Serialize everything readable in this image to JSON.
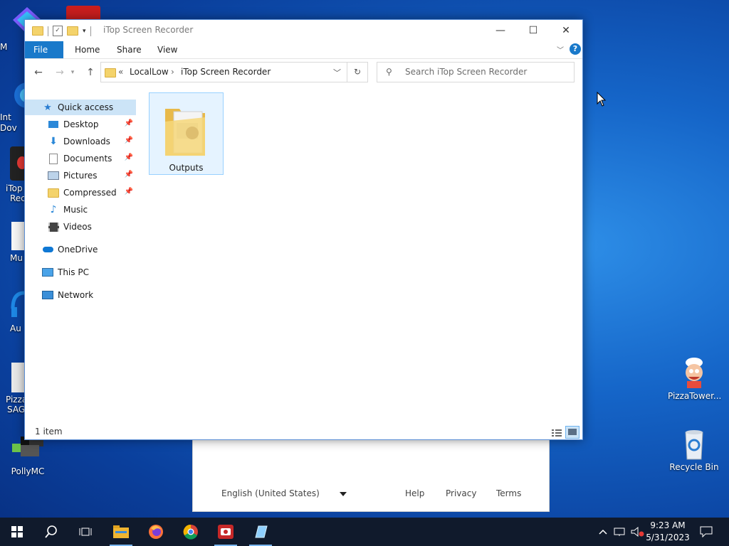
{
  "window": {
    "title": "iTop Screen Recorder",
    "tabs": [
      "File",
      "Home",
      "Share",
      "View"
    ],
    "help_label": "?"
  },
  "address": {
    "overflow": "«",
    "crumbs": [
      "LocalLow",
      "iTop Screen Recorder"
    ],
    "search_placeholder": "Search iTop Screen Recorder"
  },
  "nav": {
    "quick_access": "Quick access",
    "pinned": [
      "Desktop",
      "Downloads",
      "Documents",
      "Pictures",
      "Compressed"
    ],
    "unpinned": [
      "Music",
      "Videos"
    ],
    "onedrive": "OneDrive",
    "thispc": "This PC",
    "network": "Network"
  },
  "content": {
    "items": [
      "Outputs"
    ]
  },
  "status": {
    "count": "1 item"
  },
  "desktop": {
    "right_icons": [
      "PizzaTower...",
      "Recycle Bin"
    ],
    "left_cut_labels": [
      "M",
      "Int",
      "Dov",
      "iTop",
      "Rec",
      "Mu",
      "Au",
      "Pizza",
      "SAG",
      "PollyMC"
    ]
  },
  "browser_fragment": {
    "language": "English (United States)",
    "links": [
      "Help",
      "Privacy",
      "Terms"
    ]
  },
  "taskbar": {
    "time": "9:23 AM",
    "date": "5/31/2023"
  },
  "colors": {
    "accent": "#1979ca",
    "selection": "#cce4f7",
    "taskbar": "#101a2c"
  }
}
